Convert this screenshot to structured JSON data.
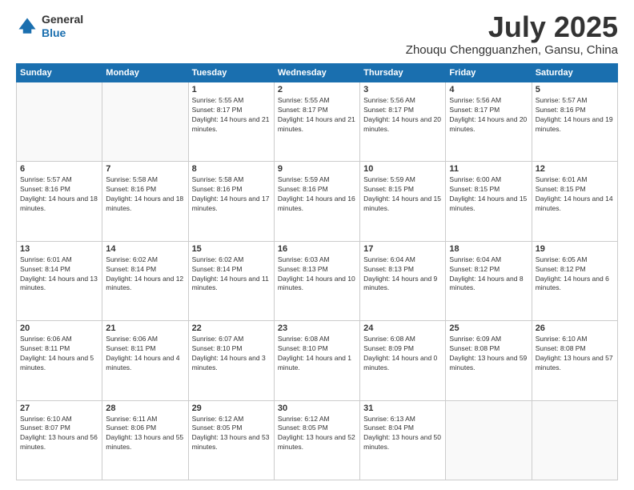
{
  "header": {
    "logo_line1": "General",
    "logo_line2": "Blue",
    "month": "July 2025",
    "location": "Zhouqu Chengguanzhen, Gansu, China"
  },
  "days_of_week": [
    "Sunday",
    "Monday",
    "Tuesday",
    "Wednesday",
    "Thursday",
    "Friday",
    "Saturday"
  ],
  "weeks": [
    [
      {
        "day": "",
        "sunrise": "",
        "sunset": "",
        "daylight": ""
      },
      {
        "day": "",
        "sunrise": "",
        "sunset": "",
        "daylight": ""
      },
      {
        "day": "1",
        "sunrise": "Sunrise: 5:55 AM",
        "sunset": "Sunset: 8:17 PM",
        "daylight": "Daylight: 14 hours and 21 minutes."
      },
      {
        "day": "2",
        "sunrise": "Sunrise: 5:55 AM",
        "sunset": "Sunset: 8:17 PM",
        "daylight": "Daylight: 14 hours and 21 minutes."
      },
      {
        "day": "3",
        "sunrise": "Sunrise: 5:56 AM",
        "sunset": "Sunset: 8:17 PM",
        "daylight": "Daylight: 14 hours and 20 minutes."
      },
      {
        "day": "4",
        "sunrise": "Sunrise: 5:56 AM",
        "sunset": "Sunset: 8:17 PM",
        "daylight": "Daylight: 14 hours and 20 minutes."
      },
      {
        "day": "5",
        "sunrise": "Sunrise: 5:57 AM",
        "sunset": "Sunset: 8:16 PM",
        "daylight": "Daylight: 14 hours and 19 minutes."
      }
    ],
    [
      {
        "day": "6",
        "sunrise": "Sunrise: 5:57 AM",
        "sunset": "Sunset: 8:16 PM",
        "daylight": "Daylight: 14 hours and 18 minutes."
      },
      {
        "day": "7",
        "sunrise": "Sunrise: 5:58 AM",
        "sunset": "Sunset: 8:16 PM",
        "daylight": "Daylight: 14 hours and 18 minutes."
      },
      {
        "day": "8",
        "sunrise": "Sunrise: 5:58 AM",
        "sunset": "Sunset: 8:16 PM",
        "daylight": "Daylight: 14 hours and 17 minutes."
      },
      {
        "day": "9",
        "sunrise": "Sunrise: 5:59 AM",
        "sunset": "Sunset: 8:16 PM",
        "daylight": "Daylight: 14 hours and 16 minutes."
      },
      {
        "day": "10",
        "sunrise": "Sunrise: 5:59 AM",
        "sunset": "Sunset: 8:15 PM",
        "daylight": "Daylight: 14 hours and 15 minutes."
      },
      {
        "day": "11",
        "sunrise": "Sunrise: 6:00 AM",
        "sunset": "Sunset: 8:15 PM",
        "daylight": "Daylight: 14 hours and 15 minutes."
      },
      {
        "day": "12",
        "sunrise": "Sunrise: 6:01 AM",
        "sunset": "Sunset: 8:15 PM",
        "daylight": "Daylight: 14 hours and 14 minutes."
      }
    ],
    [
      {
        "day": "13",
        "sunrise": "Sunrise: 6:01 AM",
        "sunset": "Sunset: 8:14 PM",
        "daylight": "Daylight: 14 hours and 13 minutes."
      },
      {
        "day": "14",
        "sunrise": "Sunrise: 6:02 AM",
        "sunset": "Sunset: 8:14 PM",
        "daylight": "Daylight: 14 hours and 12 minutes."
      },
      {
        "day": "15",
        "sunrise": "Sunrise: 6:02 AM",
        "sunset": "Sunset: 8:14 PM",
        "daylight": "Daylight: 14 hours and 11 minutes."
      },
      {
        "day": "16",
        "sunrise": "Sunrise: 6:03 AM",
        "sunset": "Sunset: 8:13 PM",
        "daylight": "Daylight: 14 hours and 10 minutes."
      },
      {
        "day": "17",
        "sunrise": "Sunrise: 6:04 AM",
        "sunset": "Sunset: 8:13 PM",
        "daylight": "Daylight: 14 hours and 9 minutes."
      },
      {
        "day": "18",
        "sunrise": "Sunrise: 6:04 AM",
        "sunset": "Sunset: 8:12 PM",
        "daylight": "Daylight: 14 hours and 8 minutes."
      },
      {
        "day": "19",
        "sunrise": "Sunrise: 6:05 AM",
        "sunset": "Sunset: 8:12 PM",
        "daylight": "Daylight: 14 hours and 6 minutes."
      }
    ],
    [
      {
        "day": "20",
        "sunrise": "Sunrise: 6:06 AM",
        "sunset": "Sunset: 8:11 PM",
        "daylight": "Daylight: 14 hours and 5 minutes."
      },
      {
        "day": "21",
        "sunrise": "Sunrise: 6:06 AM",
        "sunset": "Sunset: 8:11 PM",
        "daylight": "Daylight: 14 hours and 4 minutes."
      },
      {
        "day": "22",
        "sunrise": "Sunrise: 6:07 AM",
        "sunset": "Sunset: 8:10 PM",
        "daylight": "Daylight: 14 hours and 3 minutes."
      },
      {
        "day": "23",
        "sunrise": "Sunrise: 6:08 AM",
        "sunset": "Sunset: 8:10 PM",
        "daylight": "Daylight: 14 hours and 1 minute."
      },
      {
        "day": "24",
        "sunrise": "Sunrise: 6:08 AM",
        "sunset": "Sunset: 8:09 PM",
        "daylight": "Daylight: 14 hours and 0 minutes."
      },
      {
        "day": "25",
        "sunrise": "Sunrise: 6:09 AM",
        "sunset": "Sunset: 8:08 PM",
        "daylight": "Daylight: 13 hours and 59 minutes."
      },
      {
        "day": "26",
        "sunrise": "Sunrise: 6:10 AM",
        "sunset": "Sunset: 8:08 PM",
        "daylight": "Daylight: 13 hours and 57 minutes."
      }
    ],
    [
      {
        "day": "27",
        "sunrise": "Sunrise: 6:10 AM",
        "sunset": "Sunset: 8:07 PM",
        "daylight": "Daylight: 13 hours and 56 minutes."
      },
      {
        "day": "28",
        "sunrise": "Sunrise: 6:11 AM",
        "sunset": "Sunset: 8:06 PM",
        "daylight": "Daylight: 13 hours and 55 minutes."
      },
      {
        "day": "29",
        "sunrise": "Sunrise: 6:12 AM",
        "sunset": "Sunset: 8:05 PM",
        "daylight": "Daylight: 13 hours and 53 minutes."
      },
      {
        "day": "30",
        "sunrise": "Sunrise: 6:12 AM",
        "sunset": "Sunset: 8:05 PM",
        "daylight": "Daylight: 13 hours and 52 minutes."
      },
      {
        "day": "31",
        "sunrise": "Sunrise: 6:13 AM",
        "sunset": "Sunset: 8:04 PM",
        "daylight": "Daylight: 13 hours and 50 minutes."
      },
      {
        "day": "",
        "sunrise": "",
        "sunset": "",
        "daylight": ""
      },
      {
        "day": "",
        "sunrise": "",
        "sunset": "",
        "daylight": ""
      }
    ]
  ]
}
